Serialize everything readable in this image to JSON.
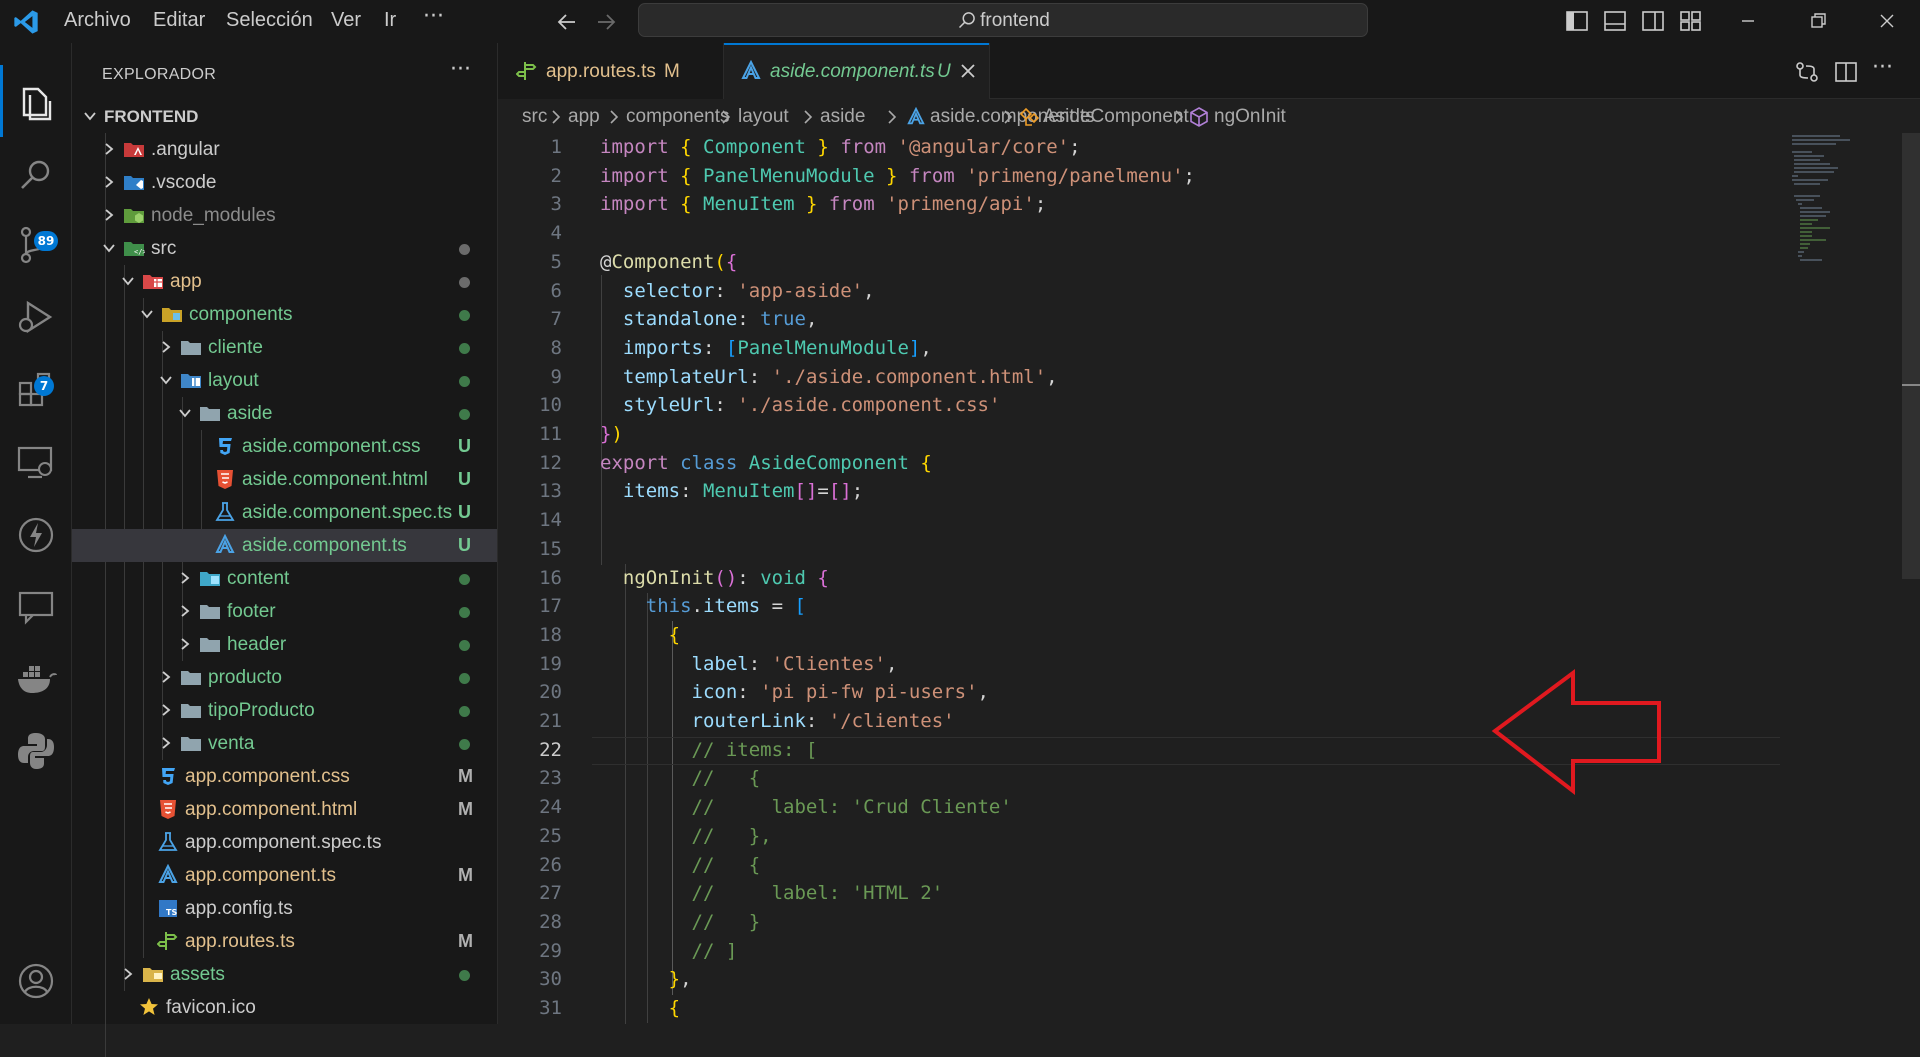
{
  "titlebar": {
    "menu": [
      "Archivo",
      "Editar",
      "Selección",
      "Ver",
      "Ir"
    ],
    "more": "···",
    "search_text": "frontend"
  },
  "activitybar": {
    "source_control_badge": "89",
    "extensions_badge": "7"
  },
  "sidebar": {
    "title": "EXPLORADOR",
    "more": "···",
    "tree": [
      {
        "label": "FRONTEND",
        "depth": 0,
        "kind": "root",
        "expanded": true,
        "bold": true
      },
      {
        "label": ".angular",
        "depth": 1,
        "kind": "folder",
        "icon": "angular-folder-icon",
        "expanded": false
      },
      {
        "label": ".vscode",
        "depth": 1,
        "kind": "folder",
        "icon": "vscode-folder-icon",
        "expanded": false
      },
      {
        "label": "node_modules",
        "depth": 1,
        "kind": "folder",
        "icon": "node-folder-icon",
        "expanded": false,
        "dim": true
      },
      {
        "label": "src",
        "depth": 1,
        "kind": "folder",
        "icon": "src-folder-icon",
        "expanded": true,
        "status": "dot",
        "status_color": "#6b6b6b"
      },
      {
        "label": "app",
        "depth": 2,
        "kind": "folder",
        "icon": "app-folder-icon",
        "expanded": true,
        "status": "dot",
        "status_color": "#6b6b6b",
        "color": "#e2c08d"
      },
      {
        "label": "components",
        "depth": 3,
        "kind": "folder",
        "icon": "components-folder-icon",
        "expanded": true,
        "status": "dot",
        "status_color": "#3f7a4a",
        "color": "#73c991"
      },
      {
        "label": "cliente",
        "depth": 4,
        "kind": "folder",
        "icon": "folder-icon",
        "expanded": false,
        "status": "dot",
        "status_color": "#3f7a4a",
        "color": "#73c991"
      },
      {
        "label": "layout",
        "depth": 4,
        "kind": "folder",
        "icon": "layout-folder-icon",
        "expanded": true,
        "status": "dot",
        "status_color": "#3f7a4a",
        "color": "#73c991"
      },
      {
        "label": "aside",
        "depth": 5,
        "kind": "folder",
        "icon": "folder-icon",
        "expanded": true,
        "status": "dot",
        "status_color": "#3f7a4a",
        "color": "#73c991"
      },
      {
        "label": "aside.component.css",
        "depth": 6,
        "kind": "file",
        "icon": "css-file-icon",
        "status": "U",
        "status_color": "#73c991",
        "color": "#73c991"
      },
      {
        "label": "aside.component.html",
        "depth": 6,
        "kind": "file",
        "icon": "html-file-icon",
        "status": "U",
        "status_color": "#73c991",
        "color": "#73c991"
      },
      {
        "label": "aside.component.spec.ts",
        "depth": 6,
        "kind": "file",
        "icon": "test-file-icon",
        "status": "U",
        "status_color": "#73c991",
        "color": "#73c991"
      },
      {
        "label": "aside.component.ts",
        "depth": 6,
        "kind": "file",
        "icon": "angular-file-icon",
        "status": "U",
        "status_color": "#73c991",
        "color": "#73c991",
        "selected": true
      },
      {
        "label": "content",
        "depth": 5,
        "kind": "folder",
        "icon": "content-folder-icon",
        "expanded": false,
        "status": "dot",
        "status_color": "#3f7a4a",
        "color": "#73c991"
      },
      {
        "label": "footer",
        "depth": 5,
        "kind": "folder",
        "icon": "folder-icon",
        "expanded": false,
        "status": "dot",
        "status_color": "#3f7a4a",
        "color": "#73c991"
      },
      {
        "label": "header",
        "depth": 5,
        "kind": "folder",
        "icon": "folder-icon",
        "expanded": false,
        "status": "dot",
        "status_color": "#3f7a4a",
        "color": "#73c991"
      },
      {
        "label": "producto",
        "depth": 4,
        "kind": "folder",
        "icon": "folder-icon",
        "expanded": false,
        "status": "dot",
        "status_color": "#3f7a4a",
        "color": "#73c991"
      },
      {
        "label": "tipoProducto",
        "depth": 4,
        "kind": "folder",
        "icon": "folder-icon",
        "expanded": false,
        "status": "dot",
        "status_color": "#3f7a4a",
        "color": "#73c991"
      },
      {
        "label": "venta",
        "depth": 4,
        "kind": "folder",
        "icon": "folder-icon",
        "expanded": false,
        "status": "dot",
        "status_color": "#3f7a4a",
        "color": "#73c991"
      },
      {
        "label": "app.component.css",
        "depth": 3,
        "kind": "file",
        "icon": "css-file-icon",
        "status": "M",
        "status_color": "#b0b0b0",
        "color": "#e2c08d"
      },
      {
        "label": "app.component.html",
        "depth": 3,
        "kind": "file",
        "icon": "html-file-icon",
        "status": "M",
        "status_color": "#b0b0b0",
        "color": "#e2c08d"
      },
      {
        "label": "app.component.spec.ts",
        "depth": 3,
        "kind": "file",
        "icon": "test-file-icon",
        "color": "#cccccc"
      },
      {
        "label": "app.component.ts",
        "depth": 3,
        "kind": "file",
        "icon": "angular-file-icon",
        "status": "M",
        "status_color": "#b0b0b0",
        "color": "#e2c08d"
      },
      {
        "label": "app.config.ts",
        "depth": 3,
        "kind": "file",
        "icon": "ts-file-icon",
        "color": "#cccccc"
      },
      {
        "label": "app.routes.ts",
        "depth": 3,
        "kind": "file",
        "icon": "routes-file-icon",
        "status": "M",
        "status_color": "#b0b0b0",
        "color": "#e2c08d"
      },
      {
        "label": "assets",
        "depth": 2,
        "kind": "folder",
        "icon": "assets-folder-icon",
        "expanded": false,
        "status": "dot",
        "status_color": "#3f7a4a",
        "color": "#73c991"
      },
      {
        "label": "favicon.ico",
        "depth": 2,
        "kind": "file",
        "icon": "favicon-file-icon",
        "color": "#cccccc"
      }
    ]
  },
  "tabs": [
    {
      "label": "app.routes.ts",
      "status": "M",
      "icon": "routes-file-icon",
      "active": false
    },
    {
      "label": "aside.component.ts",
      "status": "U",
      "icon": "angular-file-icon",
      "active": true
    }
  ],
  "breadcrumb": [
    "src",
    "app",
    "components",
    "layout",
    "aside",
    "aside.component.ts",
    "AsideComponent",
    "ngOnInit"
  ],
  "editor": {
    "current_line": 22,
    "lines": [
      [
        [
          "k",
          "import"
        ],
        [
          "p",
          " "
        ],
        [
          "b1",
          "{"
        ],
        [
          "p",
          " "
        ],
        [
          "t",
          "Component"
        ],
        [
          "p",
          " "
        ],
        [
          "b1",
          "}"
        ],
        [
          "p",
          " "
        ],
        [
          "k",
          "from"
        ],
        [
          "p",
          " "
        ],
        [
          "s",
          "'@angular/core'"
        ],
        [
          "p",
          ";"
        ]
      ],
      [
        [
          "k",
          "import"
        ],
        [
          "p",
          " "
        ],
        [
          "b1",
          "{"
        ],
        [
          "p",
          " "
        ],
        [
          "t",
          "PanelMenuModule"
        ],
        [
          "p",
          " "
        ],
        [
          "b1",
          "}"
        ],
        [
          "p",
          " "
        ],
        [
          "k",
          "from"
        ],
        [
          "p",
          " "
        ],
        [
          "s",
          "'primeng/panelmenu'"
        ],
        [
          "p",
          ";"
        ]
      ],
      [
        [
          "k",
          "import"
        ],
        [
          "p",
          " "
        ],
        [
          "b1",
          "{"
        ],
        [
          "p",
          " "
        ],
        [
          "t",
          "MenuItem"
        ],
        [
          "p",
          " "
        ],
        [
          "b1",
          "}"
        ],
        [
          "p",
          " "
        ],
        [
          "k",
          "from"
        ],
        [
          "p",
          " "
        ],
        [
          "s",
          "'primeng/api'"
        ],
        [
          "p",
          ";"
        ]
      ],
      [],
      [
        [
          "p",
          "@"
        ],
        [
          "f",
          "Component"
        ],
        [
          "b1",
          "("
        ],
        [
          "b2",
          "{"
        ]
      ],
      [
        [
          "p",
          "  "
        ],
        [
          "v",
          "selector"
        ],
        [
          "p",
          ": "
        ],
        [
          "s",
          "'app-aside'"
        ],
        [
          "p",
          ","
        ]
      ],
      [
        [
          "p",
          "  "
        ],
        [
          "v",
          "standalone"
        ],
        [
          "p",
          ": "
        ],
        [
          "kb",
          "true"
        ],
        [
          "p",
          ","
        ]
      ],
      [
        [
          "p",
          "  "
        ],
        [
          "v",
          "imports"
        ],
        [
          "p",
          ": "
        ],
        [
          "b3",
          "["
        ],
        [
          "t",
          "PanelMenuModule"
        ],
        [
          "b3",
          "]"
        ],
        [
          "p",
          ","
        ]
      ],
      [
        [
          "p",
          "  "
        ],
        [
          "v",
          "templateUrl"
        ],
        [
          "p",
          ": "
        ],
        [
          "s",
          "'./aside.component.html'"
        ],
        [
          "p",
          ","
        ]
      ],
      [
        [
          "p",
          "  "
        ],
        [
          "v",
          "styleUrl"
        ],
        [
          "p",
          ": "
        ],
        [
          "s",
          "'./aside.component.css'"
        ]
      ],
      [
        [
          "b2",
          "}"
        ],
        [
          "b1",
          ")"
        ]
      ],
      [
        [
          "k",
          "export"
        ],
        [
          "p",
          " "
        ],
        [
          "kb",
          "class"
        ],
        [
          "p",
          " "
        ],
        [
          "t",
          "AsideComponent"
        ],
        [
          "p",
          " "
        ],
        [
          "b1",
          "{"
        ]
      ],
      [
        [
          "p",
          "  "
        ],
        [
          "v",
          "items"
        ],
        [
          "p",
          ": "
        ],
        [
          "t",
          "MenuItem"
        ],
        [
          "b2",
          "[]"
        ],
        [
          "p",
          "="
        ],
        [
          "b2",
          "[]"
        ],
        [
          "p",
          ";"
        ]
      ],
      [],
      [],
      [
        [
          "p",
          "  "
        ],
        [
          "f",
          "ngOnInit"
        ],
        [
          "b2",
          "()"
        ],
        [
          "p",
          ": "
        ],
        [
          "t",
          "void"
        ],
        [
          "p",
          " "
        ],
        [
          "b2",
          "{"
        ]
      ],
      [
        [
          "p",
          "    "
        ],
        [
          "kb",
          "this"
        ],
        [
          "p",
          "."
        ],
        [
          "v",
          "items"
        ],
        [
          "p",
          " = "
        ],
        [
          "b3",
          "["
        ]
      ],
      [
        [
          "p",
          "      "
        ],
        [
          "b1",
          "{"
        ]
      ],
      [
        [
          "p",
          "        "
        ],
        [
          "v",
          "label"
        ],
        [
          "p",
          ": "
        ],
        [
          "s",
          "'Clientes'"
        ],
        [
          "p",
          ","
        ]
      ],
      [
        [
          "p",
          "        "
        ],
        [
          "v",
          "icon"
        ],
        [
          "p",
          ": "
        ],
        [
          "s",
          "'pi pi-fw pi-users'"
        ],
        [
          "p",
          ","
        ]
      ],
      [
        [
          "p",
          "        "
        ],
        [
          "v",
          "routerLink"
        ],
        [
          "p",
          ": "
        ],
        [
          "s",
          "'/clientes'"
        ]
      ],
      [
        [
          "p",
          "        "
        ],
        [
          "c",
          "// items: ["
        ]
      ],
      [
        [
          "p",
          "        "
        ],
        [
          "c",
          "//   {"
        ]
      ],
      [
        [
          "p",
          "        "
        ],
        [
          "c",
          "//     label: 'Crud Cliente'"
        ]
      ],
      [
        [
          "p",
          "        "
        ],
        [
          "c",
          "//   },"
        ]
      ],
      [
        [
          "p",
          "        "
        ],
        [
          "c",
          "//   {"
        ]
      ],
      [
        [
          "p",
          "        "
        ],
        [
          "c",
          "//     label: 'HTML 2'"
        ]
      ],
      [
        [
          "p",
          "        "
        ],
        [
          "c",
          "//   }"
        ]
      ],
      [
        [
          "p",
          "        "
        ],
        [
          "c",
          "// ]"
        ]
      ],
      [
        [
          "p",
          "      "
        ],
        [
          "b1",
          "}"
        ],
        [
          "p",
          ","
        ]
      ],
      [
        [
          "p",
          "      "
        ],
        [
          "b1",
          "{"
        ]
      ]
    ]
  },
  "colors": {
    "accent": "#0078d4",
    "annotation_arrow": "#e0191f"
  }
}
